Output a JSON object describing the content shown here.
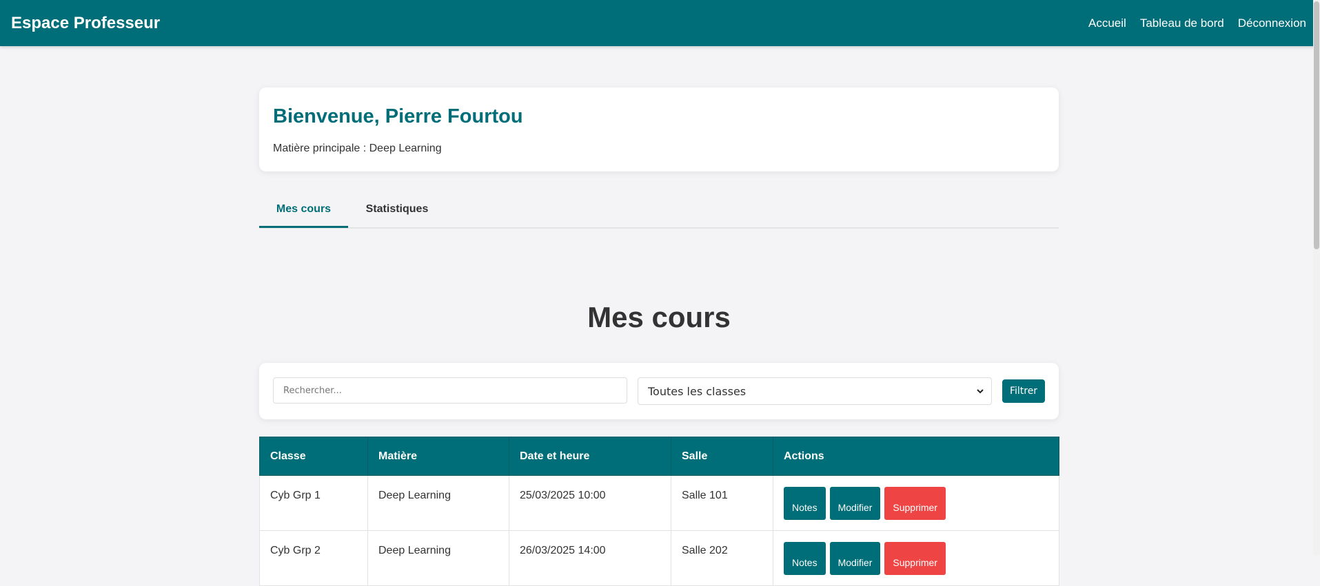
{
  "header": {
    "brand": "Espace Professeur",
    "nav": [
      "Accueil",
      "Tableau de bord",
      "Déconnexion"
    ]
  },
  "welcome": {
    "title": "Bienvenue, Pierre Fourtou",
    "subtitle": "Matière principale : Deep Learning"
  },
  "tabs": [
    {
      "label": "Mes cours",
      "active": true
    },
    {
      "label": "Statistiques",
      "active": false
    }
  ],
  "section_title": "Mes cours",
  "filters": {
    "search_placeholder": "Rechercher...",
    "class_select_value": "Toutes les classes",
    "filter_button": "Filtrer"
  },
  "table": {
    "headers": [
      "Classe",
      "Matière",
      "Date et heure",
      "Salle",
      "Actions"
    ],
    "rows": [
      {
        "classe": "Cyb Grp 1",
        "matiere": "Deep Learning",
        "date": "25/03/2025 10:00",
        "salle": "Salle 101"
      },
      {
        "classe": "Cyb Grp 2",
        "matiere": "Deep Learning",
        "date": "26/03/2025 14:00",
        "salle": "Salle 202"
      }
    ],
    "actions": [
      "Notes",
      "Modifier",
      "Supprimer"
    ]
  },
  "colors": {
    "primary": "#006e78",
    "danger": "#ef4444",
    "background": "#f4f4f6"
  }
}
